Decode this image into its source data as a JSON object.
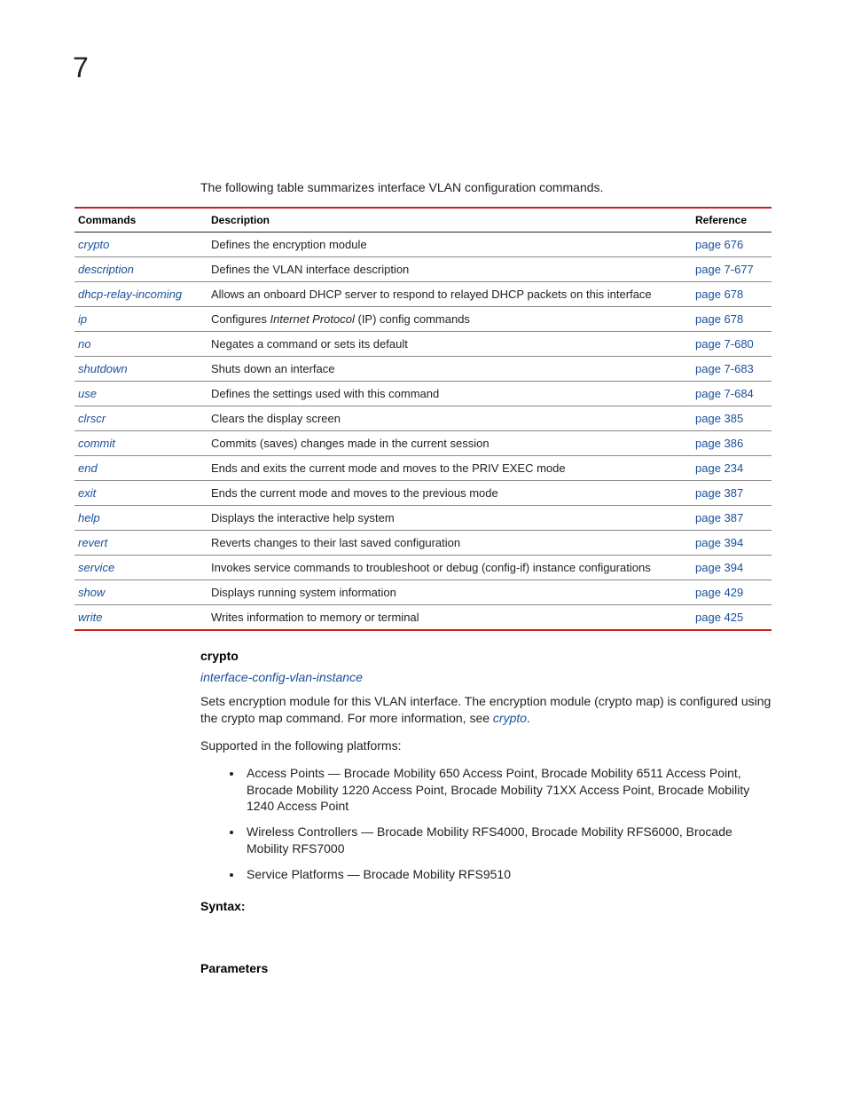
{
  "chapter": "7",
  "intro": "The following table summarizes interface VLAN configuration commands.",
  "headers": {
    "cmd": "Commands",
    "desc": "Description",
    "ref": "Reference"
  },
  "rows": [
    {
      "cmd": "crypto",
      "desc": "Defines the encryption module",
      "ref": "page 676"
    },
    {
      "cmd": "description",
      "desc": "Defines the VLAN interface description",
      "ref": "page 7-677"
    },
    {
      "cmd": "dhcp-relay-incoming",
      "desc": "Allows an onboard DHCP server to respond to relayed DHCP packets on this interface",
      "ref": "page 678"
    },
    {
      "cmd": "ip",
      "desc_pre": "Configures ",
      "desc_ital": "Internet Protocol",
      "desc_post": " (IP) config commands",
      "ref": "page 678"
    },
    {
      "cmd": "no",
      "desc": "Negates a command or sets its default",
      "ref": "page 7-680"
    },
    {
      "cmd": "shutdown",
      "desc": "Shuts down an interface",
      "ref": "page 7-683"
    },
    {
      "cmd": "use",
      "desc": "Defines the settings used with this command",
      "ref": "page 7-684"
    },
    {
      "cmd": "clrscr",
      "desc": "Clears the display screen",
      "ref": "page 385"
    },
    {
      "cmd": "commit",
      "desc": "Commits (saves) changes made in the current session",
      "ref": "page 386"
    },
    {
      "cmd": "end",
      "desc": "Ends and exits the current mode and moves to the PRIV EXEC mode",
      "ref": "page 234"
    },
    {
      "cmd": "exit",
      "desc": "Ends the current mode and moves to the previous mode",
      "ref": "page 387"
    },
    {
      "cmd": "help",
      "desc": "Displays the interactive help system",
      "ref": "page 387"
    },
    {
      "cmd": "revert",
      "desc": "Reverts changes to their last saved configuration",
      "ref": "page 394"
    },
    {
      "cmd": "service",
      "desc": "Invokes service commands to troubleshoot or debug (config-if) instance configurations",
      "ref": "page 394"
    },
    {
      "cmd": "show",
      "desc": "Displays running system information",
      "ref": "page 429"
    },
    {
      "cmd": "write",
      "desc": "Writes information to memory or terminal",
      "ref": "page 425"
    }
  ],
  "crypto": {
    "heading": "crypto",
    "context_link": "interface-config-vlan-instance",
    "para1_pre": "Sets encryption module for this VLAN interface. The encryption module (crypto map) is configured using the crypto map command. For more information, see ",
    "para1_link": "crypto",
    "para1_post": ".",
    "para2": "Supported in the following platforms:",
    "platforms": [
      "Access Points — Brocade Mobility 650 Access Point, Brocade Mobility 6511 Access Point, Brocade Mobility 1220 Access Point, Brocade Mobility 71XX Access Point, Brocade Mobility 1240 Access Point",
      "Wireless Controllers — Brocade Mobility RFS4000, Brocade Mobility RFS6000, Brocade Mobility RFS7000",
      "Service Platforms — Brocade Mobility RFS9510"
    ],
    "syntax": "Syntax:",
    "parameters": "Parameters"
  }
}
